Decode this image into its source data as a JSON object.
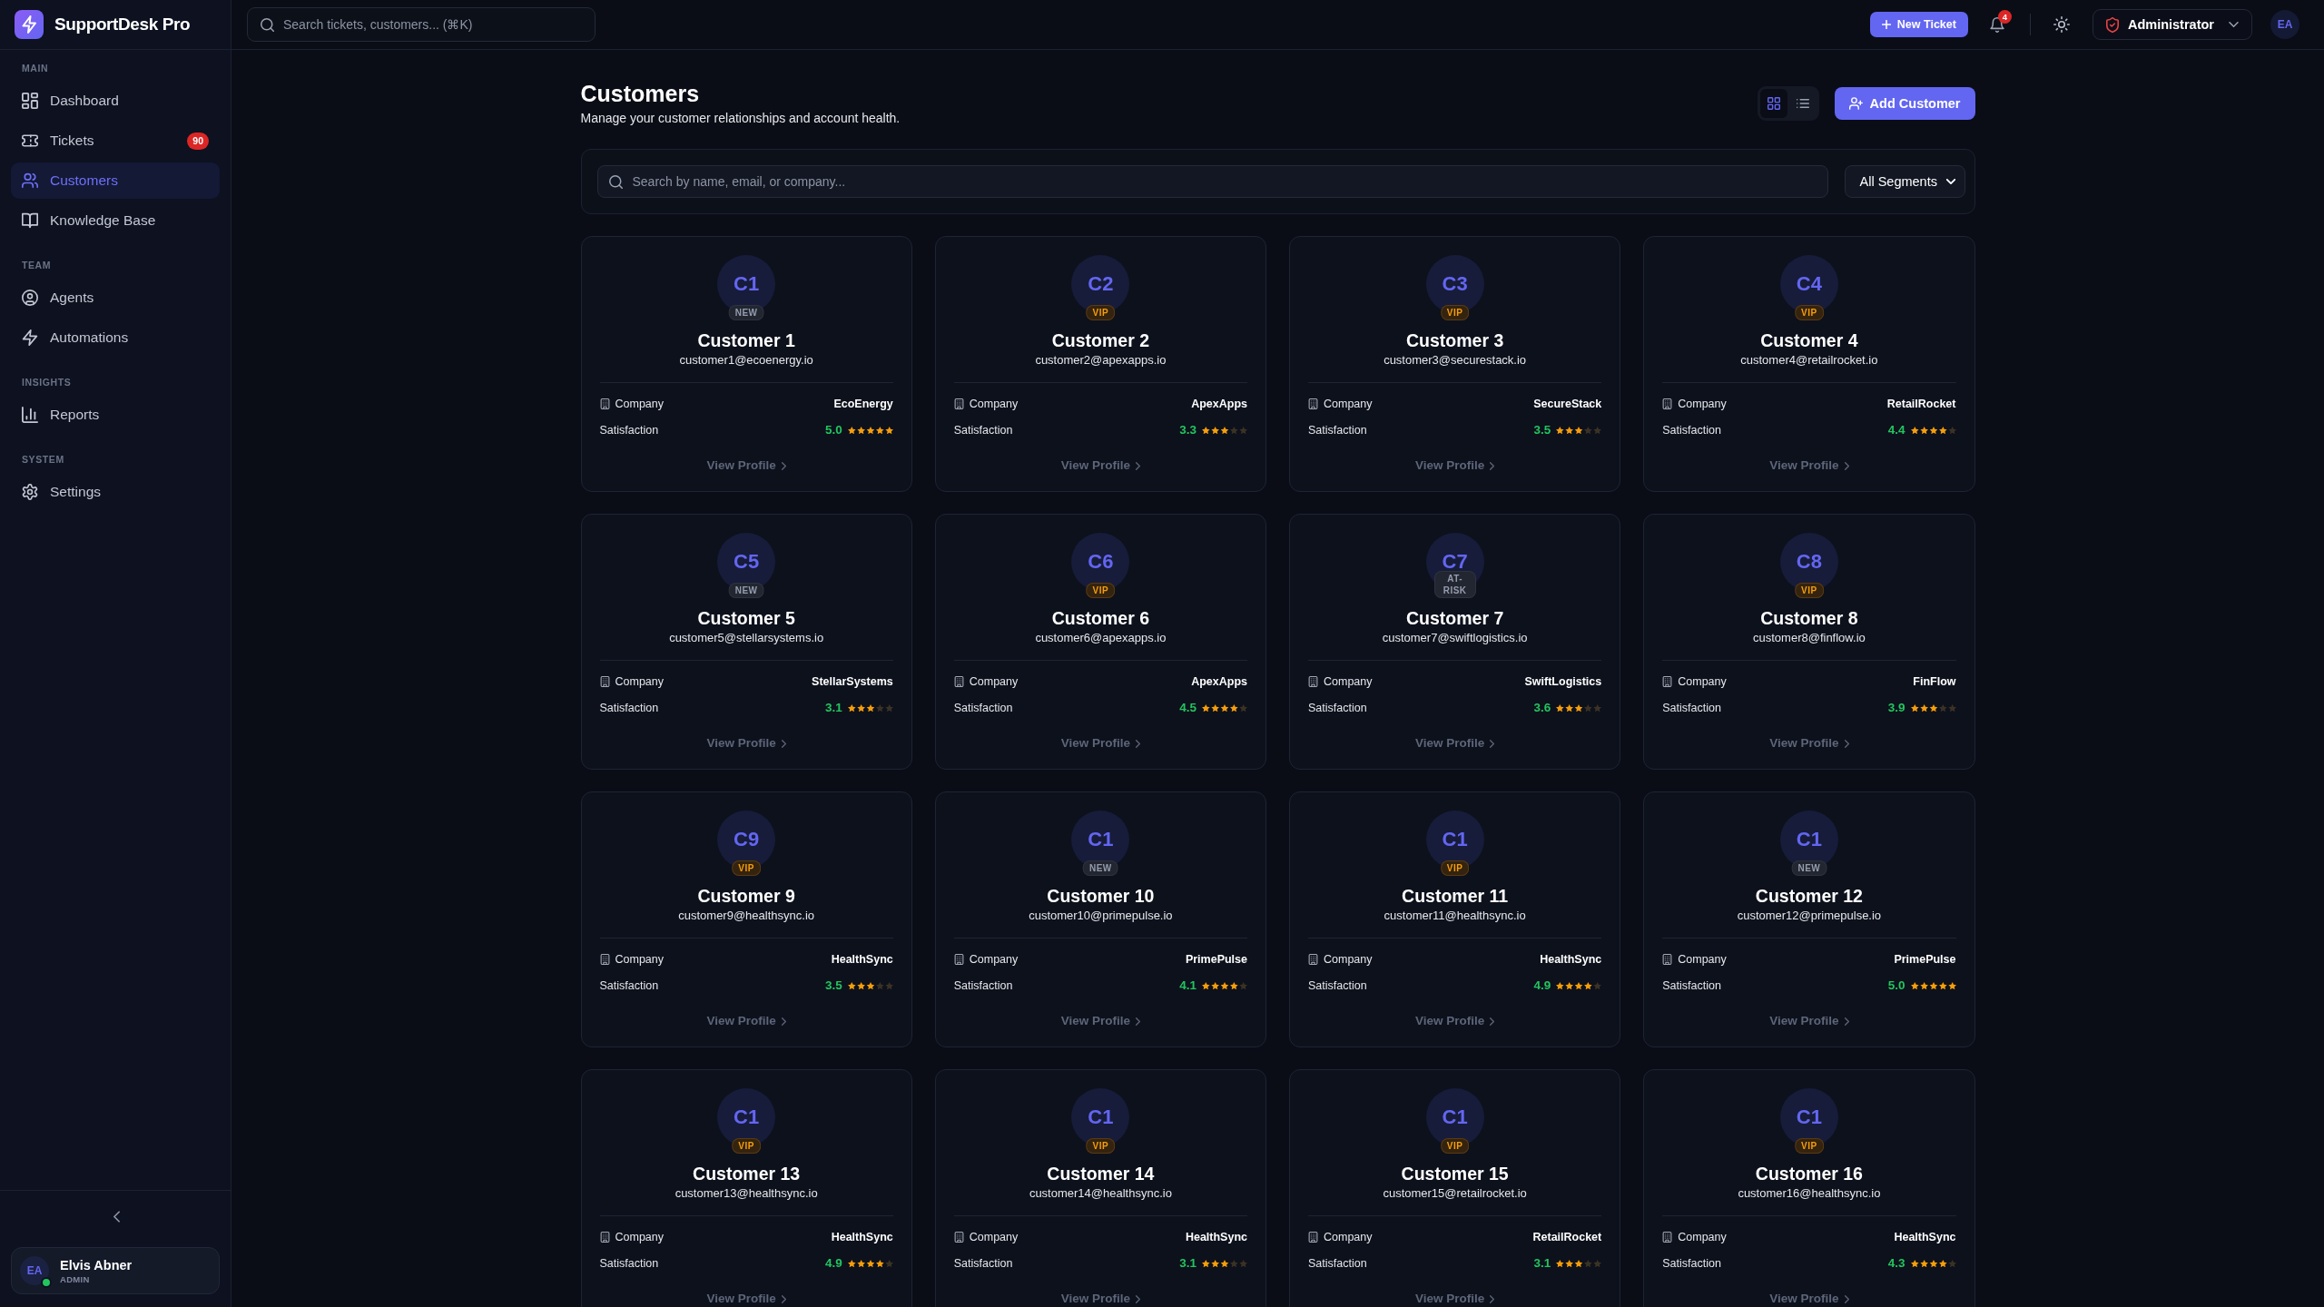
{
  "brand": {
    "name": "SupportDesk Pro"
  },
  "sidebar": {
    "sections": [
      {
        "label": "MAIN",
        "items": [
          {
            "label": "Dashboard",
            "selected": false
          },
          {
            "label": "Tickets",
            "badge": "90",
            "selected": false
          },
          {
            "label": "Customers",
            "selected": true
          },
          {
            "label": "Knowledge Base",
            "selected": false
          }
        ]
      },
      {
        "label": "TEAM",
        "items": [
          {
            "label": "Agents",
            "selected": false
          },
          {
            "label": "Automations",
            "selected": false
          }
        ]
      },
      {
        "label": "INSIGHTS",
        "items": [
          {
            "label": "Reports",
            "selected": false
          }
        ]
      },
      {
        "label": "SYSTEM",
        "items": [
          {
            "label": "Settings",
            "selected": false
          }
        ]
      }
    ],
    "user": {
      "initials": "EA",
      "name": "Elvis Abner",
      "role": "ADMIN",
      "online": true
    }
  },
  "topbar": {
    "search": {
      "placeholder": "Search tickets, customers... (⌘K)"
    },
    "new_ticket_button": {
      "label": "New Ticket"
    },
    "notifications": {
      "count": "4"
    },
    "role_menu": {
      "label": "Administrator"
    },
    "avatar": {
      "initials": "EA"
    }
  },
  "page": {
    "title": "Customers",
    "subtitle": "Manage your customer relationships and account health.",
    "view_modes": [
      {
        "kind": "grid",
        "selected": true
      },
      {
        "kind": "list",
        "selected": false
      }
    ],
    "add_button": {
      "label": "Add Customer"
    },
    "filters": {
      "search": {
        "placeholder": "Search by name, email, or company..."
      },
      "segment": {
        "value": "All Segments"
      }
    }
  },
  "customers": [
    {
      "initials": "C1",
      "badge": {
        "label": "NEW",
        "kind": "neutral"
      },
      "name": "Customer 1",
      "email": "customer1@ecoenergy.io",
      "company_label": "Company",
      "company": "EcoEnergy",
      "satisfaction_label": "Satisfaction",
      "rating": "5.0",
      "stars": 5,
      "link": "View Profile"
    },
    {
      "initials": "C2",
      "badge": {
        "label": "VIP",
        "kind": "vip"
      },
      "name": "Customer 2",
      "email": "customer2@apexapps.io",
      "company_label": "Company",
      "company": "ApexApps",
      "satisfaction_label": "Satisfaction",
      "rating": "3.3",
      "stars": 3,
      "link": "View Profile"
    },
    {
      "initials": "C3",
      "badge": {
        "label": "VIP",
        "kind": "vip"
      },
      "name": "Customer 3",
      "email": "customer3@securestack.io",
      "company_label": "Company",
      "company": "SecureStack",
      "satisfaction_label": "Satisfaction",
      "rating": "3.5",
      "stars": 3,
      "link": "View Profile"
    },
    {
      "initials": "C4",
      "badge": {
        "label": "VIP",
        "kind": "vip"
      },
      "name": "Customer 4",
      "email": "customer4@retailrocket.io",
      "company_label": "Company",
      "company": "RetailRocket",
      "satisfaction_label": "Satisfaction",
      "rating": "4.4",
      "stars": 4,
      "link": "View Profile"
    },
    {
      "initials": "C5",
      "badge": {
        "label": "NEW",
        "kind": "neutral"
      },
      "name": "Customer 5",
      "email": "customer5@stellarsystems.io",
      "company_label": "Company",
      "company": "StellarSystems",
      "satisfaction_label": "Satisfaction",
      "rating": "3.1",
      "stars": 3,
      "link": "View Profile"
    },
    {
      "initials": "C6",
      "badge": {
        "label": "VIP",
        "kind": "vip"
      },
      "name": "Customer 6",
      "email": "customer6@apexapps.io",
      "company_label": "Company",
      "company": "ApexApps",
      "satisfaction_label": "Satisfaction",
      "rating": "4.5",
      "stars": 4,
      "link": "View Profile"
    },
    {
      "initials": "C7",
      "badge": {
        "label": "AT-RISK",
        "kind": "neutral"
      },
      "name": "Customer 7",
      "email": "customer7@swiftlogistics.io",
      "company_label": "Company",
      "company": "SwiftLogistics",
      "satisfaction_label": "Satisfaction",
      "rating": "3.6",
      "stars": 3,
      "link": "View Profile"
    },
    {
      "initials": "C8",
      "badge": {
        "label": "VIP",
        "kind": "vip"
      },
      "name": "Customer 8",
      "email": "customer8@finflow.io",
      "company_label": "Company",
      "company": "FinFlow",
      "satisfaction_label": "Satisfaction",
      "rating": "3.9",
      "stars": 3,
      "link": "View Profile"
    },
    {
      "initials": "C9",
      "badge": {
        "label": "VIP",
        "kind": "vip"
      },
      "name": "Customer 9",
      "email": "customer9@healthsync.io",
      "company_label": "Company",
      "company": "HealthSync",
      "satisfaction_label": "Satisfaction",
      "rating": "3.5",
      "stars": 3,
      "link": "View Profile"
    },
    {
      "initials": "C1",
      "badge": {
        "label": "NEW",
        "kind": "neutral"
      },
      "name": "Customer 10",
      "email": "customer10@primepulse.io",
      "company_label": "Company",
      "company": "PrimePulse",
      "satisfaction_label": "Satisfaction",
      "rating": "4.1",
      "stars": 4,
      "link": "View Profile"
    },
    {
      "initials": "C1",
      "badge": {
        "label": "VIP",
        "kind": "vip"
      },
      "name": "Customer 11",
      "email": "customer11@healthsync.io",
      "company_label": "Company",
      "company": "HealthSync",
      "satisfaction_label": "Satisfaction",
      "rating": "4.9",
      "stars": 4,
      "link": "View Profile"
    },
    {
      "initials": "C1",
      "badge": {
        "label": "NEW",
        "kind": "neutral"
      },
      "name": "Customer 12",
      "email": "customer12@primepulse.io",
      "company_label": "Company",
      "company": "PrimePulse",
      "satisfaction_label": "Satisfaction",
      "rating": "5.0",
      "stars": 5,
      "link": "View Profile"
    },
    {
      "initials": "C1",
      "badge": {
        "label": "VIP",
        "kind": "vip"
      },
      "name": "Customer 13",
      "email": "customer13@healthsync.io",
      "company_label": "Company",
      "company": "HealthSync",
      "satisfaction_label": "Satisfaction",
      "rating": "4.9",
      "stars": 4,
      "link": "View Profile"
    },
    {
      "initials": "C1",
      "badge": {
        "label": "VIP",
        "kind": "vip"
      },
      "name": "Customer 14",
      "email": "customer14@healthsync.io",
      "company_label": "Company",
      "company": "HealthSync",
      "satisfaction_label": "Satisfaction",
      "rating": "3.1",
      "stars": 3,
      "link": "View Profile"
    },
    {
      "initials": "C1",
      "badge": {
        "label": "VIP",
        "kind": "vip"
      },
      "name": "Customer 15",
      "email": "customer15@retailrocket.io",
      "company_label": "Company",
      "company": "RetailRocket",
      "satisfaction_label": "Satisfaction",
      "rating": "3.1",
      "stars": 3,
      "link": "View Profile"
    },
    {
      "initials": "C1",
      "badge": {
        "label": "VIP",
        "kind": "vip"
      },
      "name": "Customer 16",
      "email": "customer16@healthsync.io",
      "company_label": "Company",
      "company": "HealthSync",
      "satisfaction_label": "Satisfaction",
      "rating": "4.3",
      "stars": 4,
      "link": "View Profile"
    }
  ]
}
